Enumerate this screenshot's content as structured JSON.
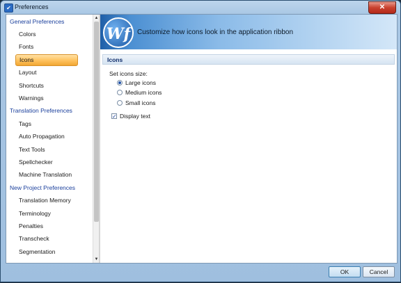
{
  "window": {
    "title": "Preferences",
    "close_label": "✕"
  },
  "sidebar": {
    "items": [
      {
        "label": "General Preferences",
        "level": "group"
      },
      {
        "label": "Colors",
        "level": "sub"
      },
      {
        "label": "Fonts",
        "level": "sub"
      },
      {
        "label": "Icons",
        "level": "sub",
        "selected": true
      },
      {
        "label": "Layout",
        "level": "sub"
      },
      {
        "label": "Shortcuts",
        "level": "sub"
      },
      {
        "label": "Warnings",
        "level": "sub"
      },
      {
        "label": "Translation Preferences",
        "level": "group"
      },
      {
        "label": "Tags",
        "level": "sub"
      },
      {
        "label": "Auto Propagation",
        "level": "sub"
      },
      {
        "label": "Text Tools",
        "level": "sub"
      },
      {
        "label": "Spellchecker",
        "level": "sub"
      },
      {
        "label": "Machine Translation",
        "level": "sub"
      },
      {
        "label": "New Project Preferences",
        "level": "group"
      },
      {
        "label": "Translation Memory",
        "level": "sub"
      },
      {
        "label": "Terminology",
        "level": "sub"
      },
      {
        "label": "Penalties",
        "level": "sub"
      },
      {
        "label": "Transcheck",
        "level": "sub"
      },
      {
        "label": "Segmentation",
        "level": "sub"
      }
    ]
  },
  "banner": {
    "logo_text": "Wf",
    "text": "Customize how icons look in the application ribbon"
  },
  "section": {
    "title": "Icons",
    "size_label": "Set icons size:",
    "options": [
      {
        "label": "Large icons",
        "checked": true
      },
      {
        "label": "Medium icons",
        "checked": false
      },
      {
        "label": "Small icons",
        "checked": false
      }
    ],
    "display_text": {
      "label": "Display text",
      "checked": true
    }
  },
  "footer": {
    "ok_label": "OK",
    "cancel_label": "Cancel"
  },
  "colors": {
    "accent": "#f2a733",
    "group_text": "#1a3f9c",
    "header_text": "#0f2d6b"
  }
}
